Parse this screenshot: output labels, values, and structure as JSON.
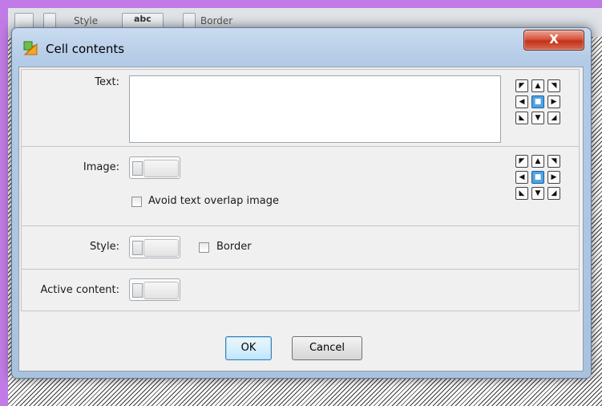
{
  "background": {
    "toolbar_fragments": [
      "Style",
      "abc",
      "Border"
    ]
  },
  "dialog": {
    "title": "Cell contents",
    "close_glyph": "X",
    "text_section": {
      "label": "Text:",
      "value": ""
    },
    "image_section": {
      "label": "Image:",
      "avoid_overlap_label": "Avoid text overlap image",
      "avoid_overlap_checked": false
    },
    "style_section": {
      "label": "Style:",
      "border_label": "Border",
      "border_checked": false
    },
    "active_section": {
      "label": "Active content:"
    },
    "alignment": {
      "glyphs": [
        "◤",
        "▲",
        "◥",
        "◀",
        "■",
        "▶",
        "◣",
        "▼",
        "◢"
      ],
      "selected": "center"
    },
    "buttons": {
      "ok": "OK",
      "cancel": "Cancel"
    }
  },
  "colors": {
    "highlight_frame": "#c27be6",
    "close_red": "#c2321a",
    "selected_align": "#4ea3e6"
  }
}
